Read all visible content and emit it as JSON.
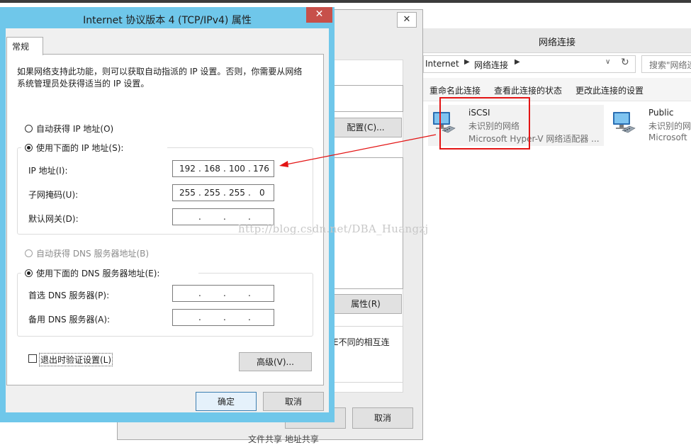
{
  "network_window": {
    "title": "网络连接",
    "breadcrumb": [
      "Internet",
      "网络连接"
    ],
    "search_placeholder": "搜索\"网络连",
    "commands": [
      "重命名此连接",
      "查看此连接的状态",
      "更改此连接的设置"
    ],
    "adapters": [
      {
        "name": "iSCSI",
        "status": "未识别的网络",
        "device": "Microsoft Hyper-V 网络适配器 ...",
        "selected": true
      },
      {
        "name": "Public",
        "status": "未识别的网络",
        "device": "Microsoft"
      }
    ]
  },
  "middle_dialog": {
    "close": "✕",
    "configure_label": "配置(C)...",
    "properties_label": "属性(R)",
    "description_fragment": "E不同的相互连",
    "cancel_label": "取消",
    "bottom_text": "文件共享    地址共享"
  },
  "ipv4_dialog": {
    "title": "Internet 协议版本 4 (TCP/IPv4) 属性",
    "close": "✕",
    "tab": "常规",
    "intro": "如果网络支持此功能，则可以获取自动指派的 IP 设置。否则，你需要从网络系统管理员处获得适当的 IP 设置。",
    "auto_ip_label": "自动获得 IP 地址(O)",
    "manual_ip_label": "使用下面的 IP 地址(S):",
    "ip_label": "IP 地址(I):",
    "ip_value": [
      "192",
      "168",
      "100",
      "176"
    ],
    "mask_label": "子网掩码(U):",
    "mask_value": [
      "255",
      "255",
      "255",
      "0"
    ],
    "gateway_label": "默认网关(D):",
    "auto_dns_label": "自动获得 DNS 服务器地址(B)",
    "manual_dns_label": "使用下面的 DNS 服务器地址(E):",
    "preferred_dns_label": "首选 DNS 服务器(P):",
    "alternate_dns_label": "备用 DNS 服务器(A):",
    "validate_label": "退出时验证设置(L)",
    "advanced_label": "高级(V)...",
    "ok_label": "确定",
    "cancel_label": "取消"
  },
  "watermark": "http://blog.csdn.net/DBA_Huangzj",
  "colors": {
    "title_bar": "#6fc7ea",
    "close_button": "#c7504a",
    "annotation": "#e31414"
  }
}
